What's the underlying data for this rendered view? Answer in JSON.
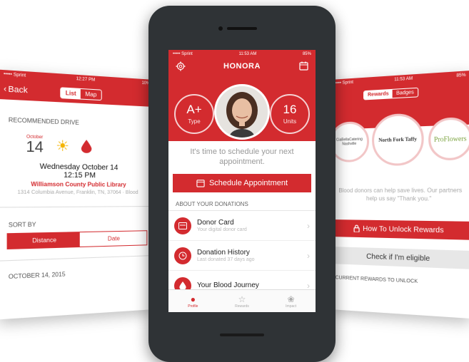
{
  "colors": {
    "brand_red": "#d32b2f",
    "light_pink": "#f5d0d1"
  },
  "left": {
    "status": {
      "carrier": "••••• Sprint",
      "time": "12:27 PM",
      "battery": "10%"
    },
    "back_label": "Back",
    "segments": [
      "List",
      "Map"
    ],
    "recommended_title": "RECOMMENDED DRIVE",
    "drive": {
      "month": "October",
      "day": "14",
      "weather_icon": "sun-icon",
      "date_line": "Wednesday October 14",
      "time_line": "12:15 PM",
      "venue": "Williamson County Public Library",
      "address": "1314 Columbia Avenue, Franklin, TN, 37064 · Blood"
    },
    "sort_title": "SORT BY",
    "sort_options": [
      "Distance",
      "Date"
    ],
    "date_header": "OCTOBER 14, 2015"
  },
  "center": {
    "status": {
      "carrier": "••••• Sprint",
      "time": "11:53 AM",
      "battery": "85%"
    },
    "title": "HONORA",
    "blood_type": {
      "value": "A+",
      "label": "Type"
    },
    "units": {
      "value": "16",
      "label": "Units"
    },
    "message": "It's time to schedule your next appointment.",
    "schedule_label": "Schedule Appointment",
    "about_title": "ABOUT YOUR DONATIONS",
    "rows": [
      {
        "title": "Donor Card",
        "subtitle": "Your digital donor card",
        "icon": "card-icon"
      },
      {
        "title": "Donation History",
        "subtitle": "Last donated 37 days ago",
        "icon": "clock-icon"
      },
      {
        "title": "Your Blood Journey",
        "subtitle": "",
        "icon": "drop-icon"
      }
    ],
    "tabs": [
      {
        "label": "Profile",
        "icon": "profile-icon"
      },
      {
        "label": "Rewards",
        "icon": "star-icon"
      },
      {
        "label": "Impact",
        "icon": "impact-icon"
      }
    ]
  },
  "right": {
    "status": {
      "carrier": "••••• Sprint",
      "time": "11:53 AM",
      "battery": "85%"
    },
    "segments": [
      "Rewards",
      "Badges"
    ],
    "badges": [
      {
        "text": "CiaBellaCatering Nashville"
      },
      {
        "text": "North Fork Taffy"
      },
      {
        "text": "ProFlowers"
      }
    ],
    "message": "Blood donors can help save lives. Our partners help us say \"Thank you.\"",
    "unlock_label": "How To Unlock Rewards",
    "check_label": "Check if I'm eligible",
    "current_title": "CURRENT REWARDS TO UNLOCK"
  }
}
